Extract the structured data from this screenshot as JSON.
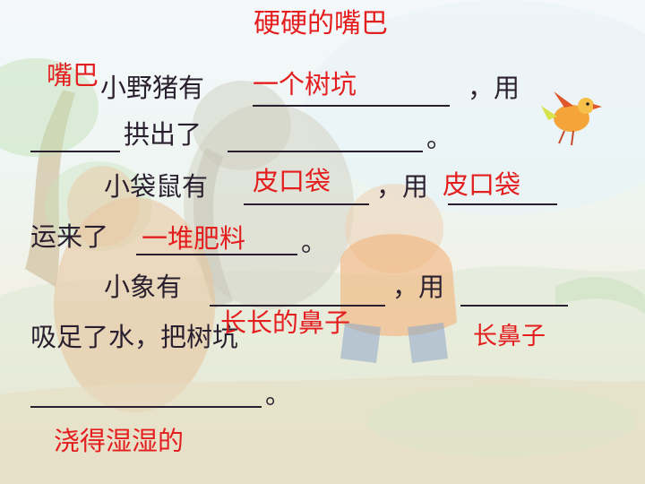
{
  "title": "硬硬的嘴巴",
  "lines": {
    "l1_pig_has": "小野猪有",
    "l1_comma_use": "，用",
    "l2_dug_out": "拱出了",
    "l2_end": "。",
    "l3_kangaroo_has": "小袋鼠有",
    "l3_comma_use": "，用",
    "l4_carried": "运来了",
    "l4_end": "。",
    "l5_elephant_has": "小象有",
    "l5_comma_use": "，用",
    "l6_sucked_water": "吸足了水，把树坑",
    "l7_end": "。"
  },
  "answers": {
    "pig_tool_top": "嘴巴",
    "pig_result": "一个树坑",
    "kangaroo_has": "皮口袋",
    "kangaroo_tool": "皮口袋",
    "kangaroo_result": "一堆肥料",
    "elephant_has": "长长的鼻子",
    "elephant_tool": "长鼻子",
    "tree_pit_result": "浇得湿湿的"
  }
}
